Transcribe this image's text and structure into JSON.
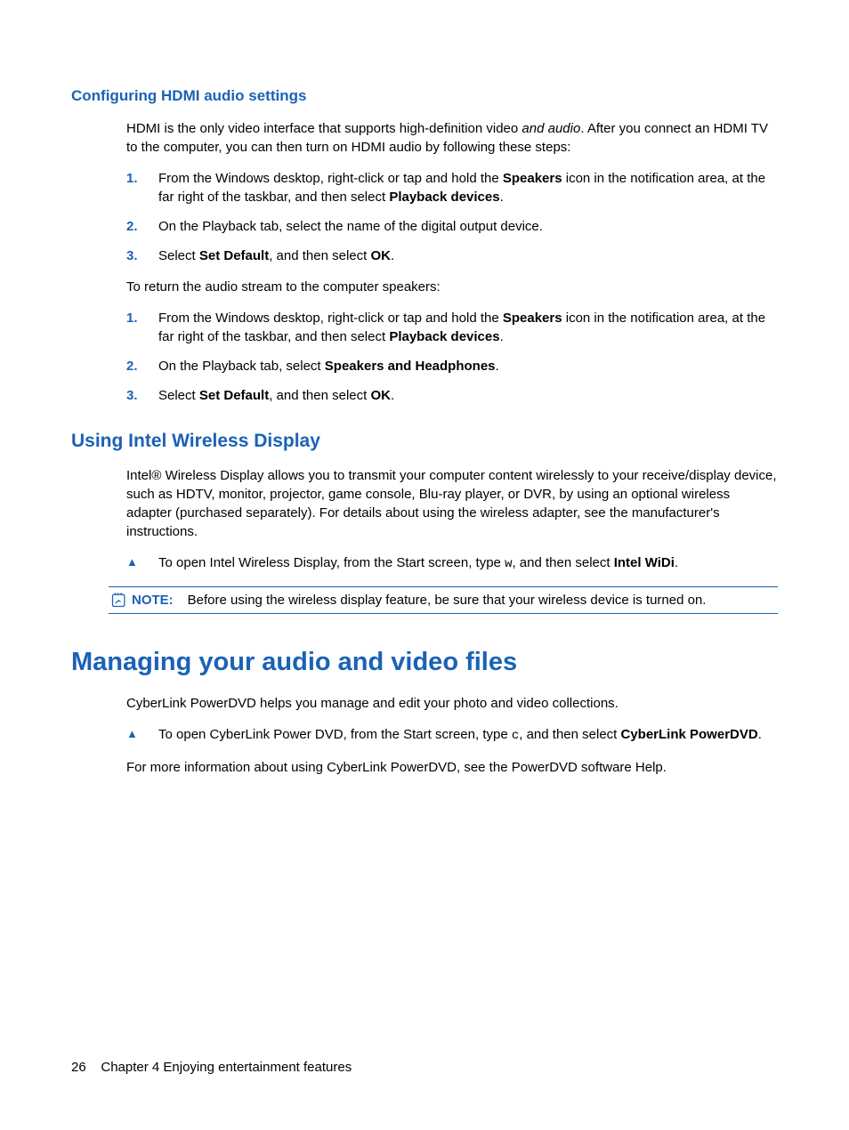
{
  "section1": {
    "heading": "Configuring HDMI audio settings",
    "intro_pre": "HDMI is the only video interface that supports high-definition video ",
    "intro_italic": "and audio",
    "intro_post": ". After you connect an HDMI TV to the computer, you can then turn on HDMI audio by following these steps:",
    "listA": {
      "i1_num": "1.",
      "i1_a": "From the Windows desktop, right-click or tap and hold the ",
      "i1_b": "Speakers",
      "i1_c": " icon in the notification area, at the far right of the taskbar, and then select ",
      "i1_d": "Playback devices",
      "i1_e": ".",
      "i2_num": "2.",
      "i2": "On the Playback tab, select the name of the digital output device.",
      "i3_num": "3.",
      "i3_a": "Select ",
      "i3_b": "Set Default",
      "i3_c": ", and then select ",
      "i3_d": "OK",
      "i3_e": "."
    },
    "between": "To return the audio stream to the computer speakers:",
    "listB": {
      "i1_num": "1.",
      "i1_a": "From the Windows desktop, right-click or tap and hold the ",
      "i1_b": "Speakers",
      "i1_c": " icon in the notification area, at the far right of the taskbar, and then select ",
      "i1_d": "Playback devices",
      "i1_e": ".",
      "i2_num": "2.",
      "i2_a": "On the Playback tab, select ",
      "i2_b": "Speakers and Headphones",
      "i2_c": ".",
      "i3_num": "3.",
      "i3_a": "Select ",
      "i3_b": "Set Default",
      "i3_c": ", and then select ",
      "i3_d": "OK",
      "i3_e": "."
    }
  },
  "section2": {
    "heading": "Using Intel Wireless Display",
    "intro": "Intel® Wireless Display allows you to transmit your computer content wirelessly to your receive/display device, such as HDTV, monitor, projector, game console, Blu-ray player, or DVR, by using an optional wireless adapter (purchased separately). For details about using the wireless adapter, see the manufacturer's instructions.",
    "bullet_a": "To open Intel Wireless Display, from the Start screen, type ",
    "bullet_w": "w",
    "bullet_b": ", and then select ",
    "bullet_c": "Intel WiDi",
    "bullet_d": ".",
    "note_label": "NOTE:",
    "note_text": "Before using the wireless display feature, be sure that your wireless device is turned on."
  },
  "section3": {
    "heading": "Managing your audio and video files",
    "intro": "CyberLink PowerDVD helps you manage and edit your photo and video collections.",
    "bullet_a": "To open CyberLink Power DVD, from the Start screen, type ",
    "bullet_c": "c",
    "bullet_b": ", and then select ",
    "bullet_bold": "CyberLink PowerDVD",
    "bullet_d": ".",
    "outro": "For more information about using CyberLink PowerDVD, see the PowerDVD software Help."
  },
  "footer": {
    "page": "26",
    "chapter": "Chapter 4   Enjoying entertainment features"
  }
}
